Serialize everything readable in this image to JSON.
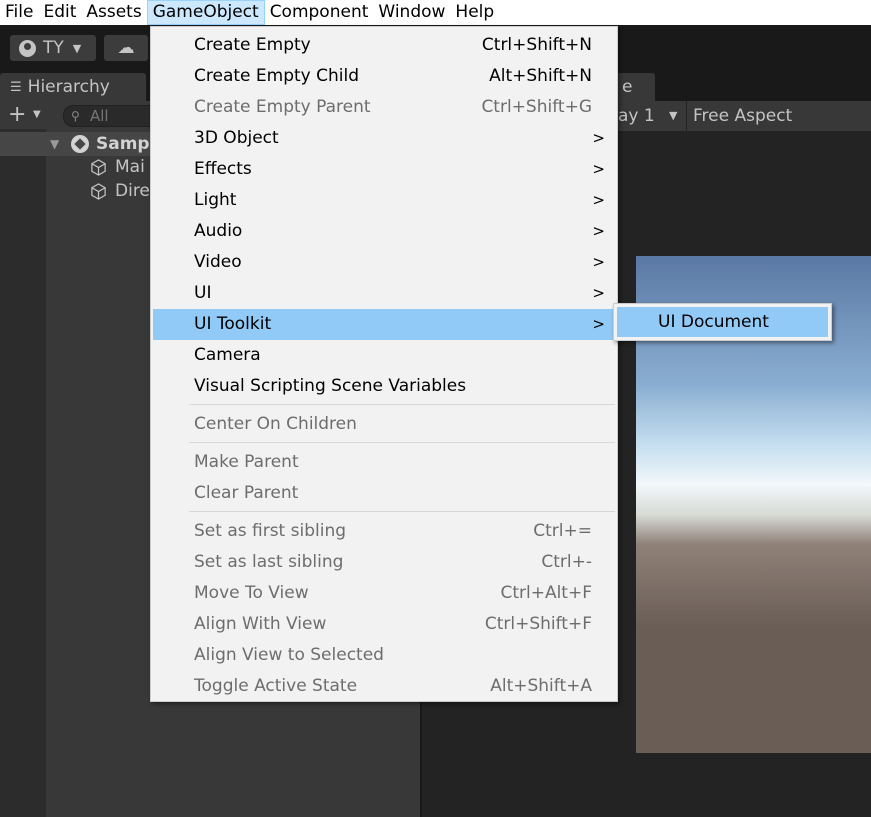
{
  "menubar": {
    "items": [
      {
        "label": "File",
        "active": false
      },
      {
        "label": "Edit",
        "active": false
      },
      {
        "label": "Assets",
        "active": false
      },
      {
        "label": "GameObject",
        "active": true
      },
      {
        "label": "Component",
        "active": false
      },
      {
        "label": "Window",
        "active": false
      },
      {
        "label": "Help",
        "active": false
      }
    ]
  },
  "toolbar": {
    "account_label": "TY",
    "account_icon": "account-icon",
    "cloud_icon": "cloud-icon"
  },
  "hierarchy": {
    "tab_label": "Hierarchy",
    "search_placeholder": "All",
    "scene_label": "Sampl",
    "objects": [
      "Mai",
      "Dire"
    ]
  },
  "game_view": {
    "tab_label": "e",
    "display_label": "ay 1",
    "aspect_label": "Free Aspect"
  },
  "gameobject_menu": {
    "items": [
      {
        "label": "Create Empty",
        "shortcut": "Ctrl+Shift+N",
        "disabled": false,
        "submenu": false
      },
      {
        "label": "Create Empty Child",
        "shortcut": "Alt+Shift+N",
        "disabled": false,
        "submenu": false
      },
      {
        "label": "Create Empty Parent",
        "shortcut": "Ctrl+Shift+G",
        "disabled": true,
        "submenu": false
      },
      {
        "label": "3D Object",
        "shortcut": "",
        "disabled": false,
        "submenu": true
      },
      {
        "label": "Effects",
        "shortcut": "",
        "disabled": false,
        "submenu": true
      },
      {
        "label": "Light",
        "shortcut": "",
        "disabled": false,
        "submenu": true
      },
      {
        "label": "Audio",
        "shortcut": "",
        "disabled": false,
        "submenu": true
      },
      {
        "label": "Video",
        "shortcut": "",
        "disabled": false,
        "submenu": true
      },
      {
        "label": "UI",
        "shortcut": "",
        "disabled": false,
        "submenu": true
      },
      {
        "label": "UI Toolkit",
        "shortcut": "",
        "disabled": false,
        "submenu": true,
        "highlighted": true
      },
      {
        "label": "Camera",
        "shortcut": "",
        "disabled": false,
        "submenu": false
      },
      {
        "label": "Visual Scripting Scene Variables",
        "shortcut": "",
        "disabled": false,
        "submenu": false
      },
      {
        "label": "Center On Children",
        "shortcut": "",
        "disabled": true,
        "submenu": false
      },
      {
        "label": "Make Parent",
        "shortcut": "",
        "disabled": true,
        "submenu": false
      },
      {
        "label": "Clear Parent",
        "shortcut": "",
        "disabled": true,
        "submenu": false
      },
      {
        "label": "Set as first sibling",
        "shortcut": "Ctrl+=",
        "disabled": true,
        "submenu": false
      },
      {
        "label": "Set as last sibling",
        "shortcut": "Ctrl+-",
        "disabled": true,
        "submenu": false
      },
      {
        "label": "Move To View",
        "shortcut": "Ctrl+Alt+F",
        "disabled": true,
        "submenu": false
      },
      {
        "label": "Align With View",
        "shortcut": "Ctrl+Shift+F",
        "disabled": true,
        "submenu": false
      },
      {
        "label": "Align View to Selected",
        "shortcut": "",
        "disabled": true,
        "submenu": false
      },
      {
        "label": "Toggle Active State",
        "shortcut": "Alt+Shift+A",
        "disabled": true,
        "submenu": false
      }
    ]
  },
  "ui_toolkit_submenu": {
    "items": [
      {
        "label": "UI Document",
        "highlighted": true
      }
    ]
  },
  "colors": {
    "menu_highlight": "#91c9f7",
    "menubar_active": "#cce8ff",
    "editor_bg": "#383838",
    "toolbar_bg": "#191919"
  }
}
